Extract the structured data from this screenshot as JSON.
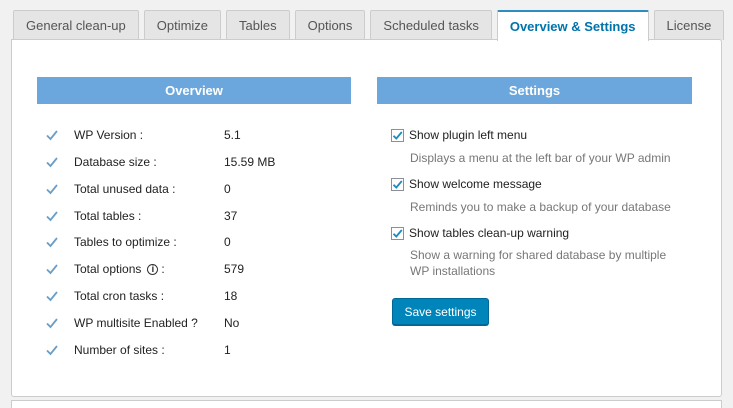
{
  "tabs": [
    {
      "label": "General clean-up",
      "active": false
    },
    {
      "label": "Optimize",
      "active": false
    },
    {
      "label": "Tables",
      "active": false
    },
    {
      "label": "Options",
      "active": false
    },
    {
      "label": "Scheduled tasks",
      "active": false
    },
    {
      "label": "Overview & Settings",
      "active": true
    },
    {
      "label": "License",
      "active": false
    }
  ],
  "overview": {
    "title": "Overview",
    "rows": [
      {
        "label": "WP Version :",
        "value": "5.1"
      },
      {
        "label": "Database size :",
        "value": "15.59 MB"
      },
      {
        "label": "Total unused data :",
        "value": "0"
      },
      {
        "label": "Total tables :",
        "value": "37"
      },
      {
        "label": "Tables to optimize :",
        "value": "0"
      },
      {
        "label": "Total options",
        "label_suffix": ":",
        "value": "579"
      },
      {
        "label": "Total cron tasks :",
        "value": "18"
      },
      {
        "label": "WP multisite Enabled ?",
        "value": "No"
      },
      {
        "label": "Number of sites :",
        "value": "1"
      }
    ]
  },
  "settings": {
    "title": "Settings",
    "items": [
      {
        "label": "Show plugin left menu",
        "description": "Displays a menu at the left bar of your WP admin",
        "checked": true
      },
      {
        "label": "Show welcome message",
        "description": "Reminds you to make a backup of your database",
        "checked": true
      },
      {
        "label": "Show tables clean-up warning",
        "description": "Show a warning for shared database by multiple WP installations",
        "checked": true
      }
    ],
    "save_label": "Save settings"
  },
  "icons": {
    "info": "info-circle-icon",
    "info_glyph": "i",
    "check": "checkmark-icon",
    "checkbox": "checkbox-checked-icon"
  },
  "colors": {
    "accent": "#0073aa",
    "header_bg": "#6ba7dc",
    "button_bg": "#0085ba",
    "check": "#6b9ec6"
  }
}
